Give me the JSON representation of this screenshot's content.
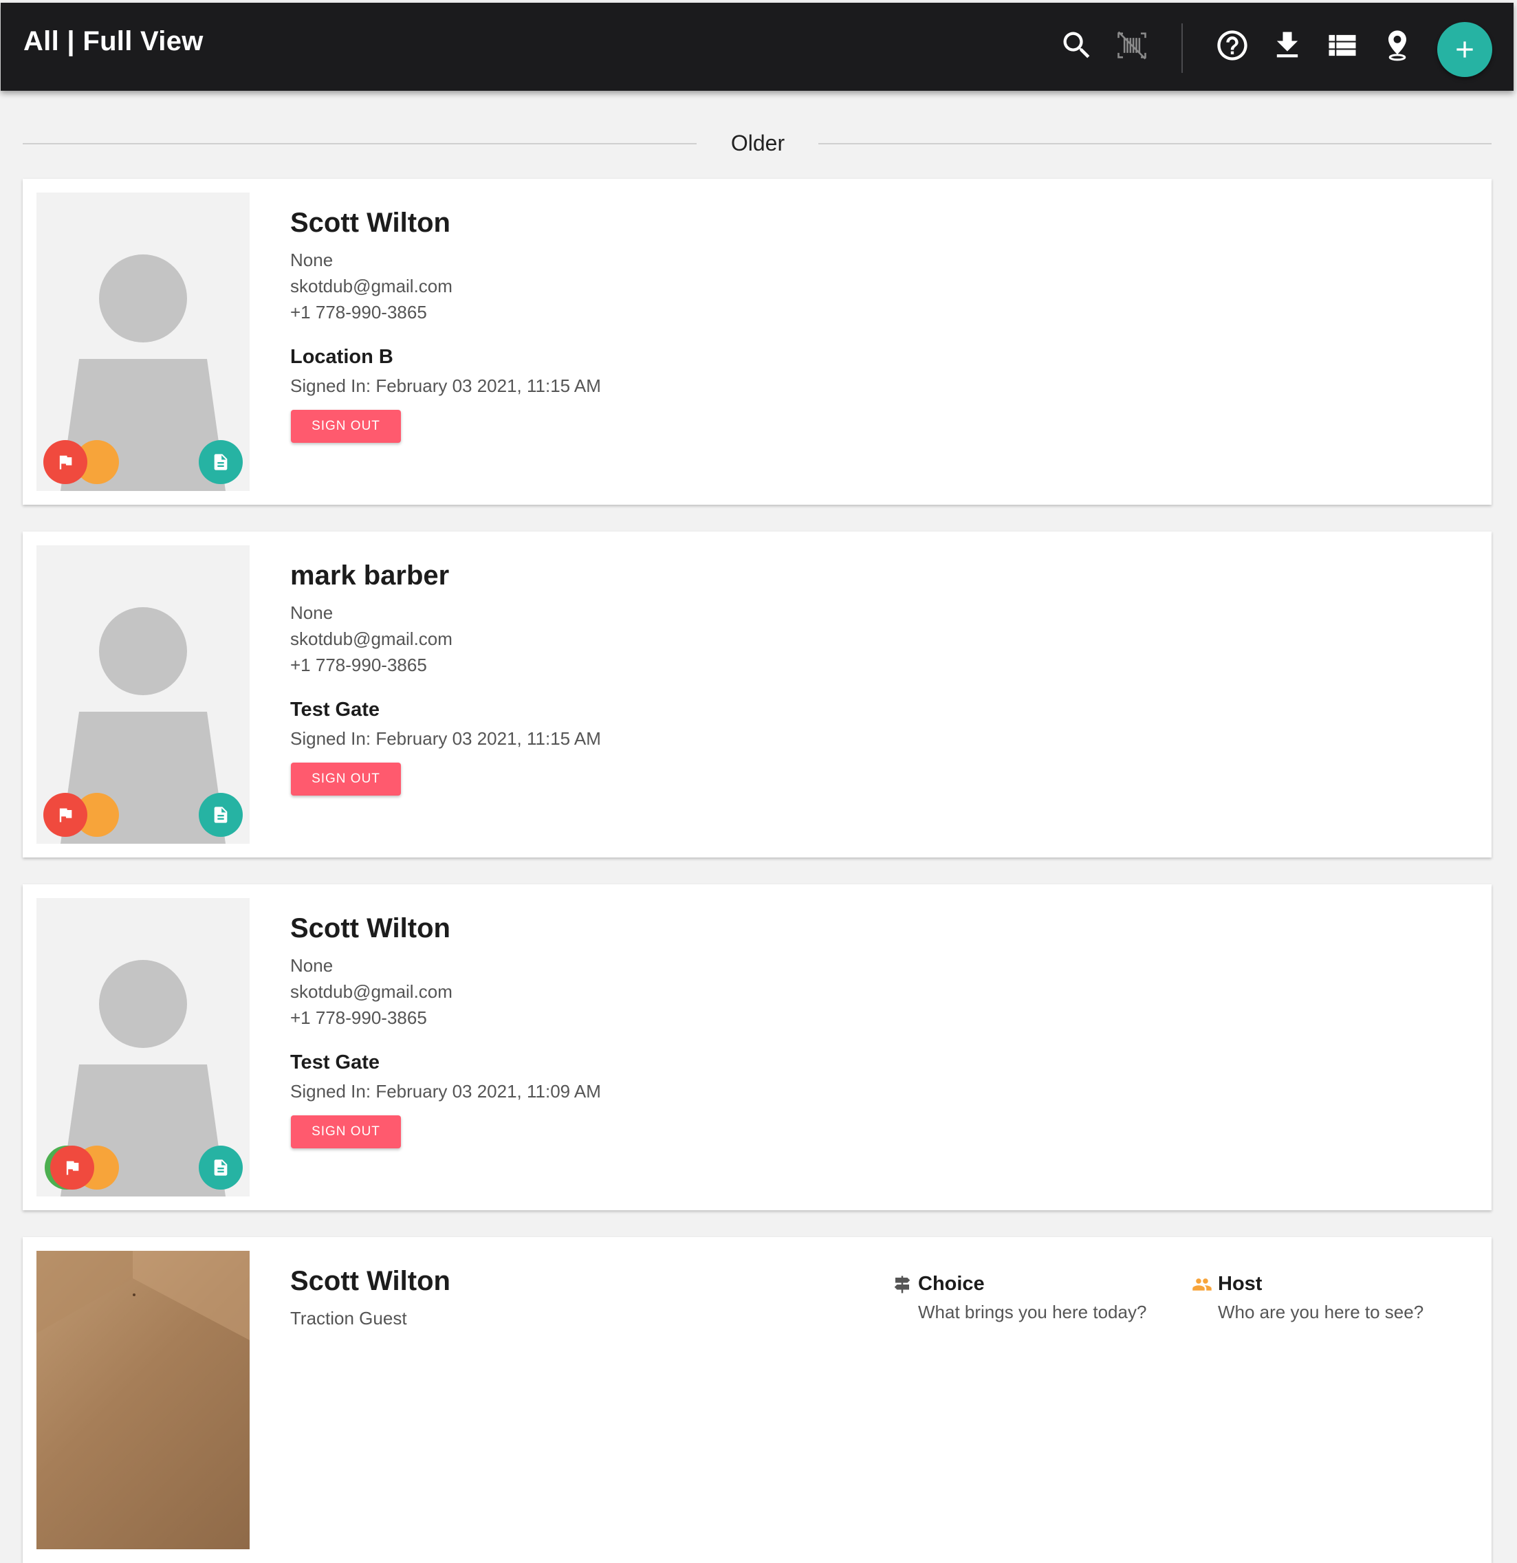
{
  "header": {
    "title": "All | Full View",
    "icons": [
      "search-icon",
      "barcode-off-icon",
      "help-icon",
      "download-icon",
      "list-icon",
      "location-pin-icon",
      "add-icon"
    ],
    "background": "#1b1b1d",
    "accent": "#26b3a3"
  },
  "section": {
    "label": "Older"
  },
  "visitors": [
    {
      "name": "Scott Wilton",
      "company": "None",
      "email": "skotdub@gmail.com",
      "phone": "+1 778-990-3865",
      "location": "Location B",
      "signed_in": "Signed In: February 03 2021, 11:15 AM",
      "sign_out_label": "SIGN OUT"
    },
    {
      "name": "mark barber",
      "company": "None",
      "email": "skotdub@gmail.com",
      "phone": "+1 778-990-3865",
      "location": "Test Gate",
      "signed_in": "Signed In: February 03 2021, 11:15 AM",
      "sign_out_label": "SIGN OUT"
    },
    {
      "name": "Scott Wilton",
      "company": "None",
      "email": "skotdub@gmail.com",
      "phone": "+1 778-990-3865",
      "location": "Test Gate",
      "signed_in": "Signed In: February 03 2021, 11:09 AM",
      "sign_out_label": "SIGN OUT"
    },
    {
      "name": "Scott Wilton",
      "company": "Traction Guest",
      "fields": [
        {
          "icon": "signpost-icon",
          "label": "Choice",
          "question": "What brings you here today?"
        },
        {
          "icon": "people-icon",
          "label": "Host",
          "question": "Who are you here to see?"
        }
      ]
    }
  ],
  "colors": {
    "sign_out": "#ff5a6e",
    "flag_badge": "#f04a3e",
    "orange_badge": "#f7a43a",
    "green_badge": "#4caf50",
    "doc_badge": "#26b3a3"
  }
}
